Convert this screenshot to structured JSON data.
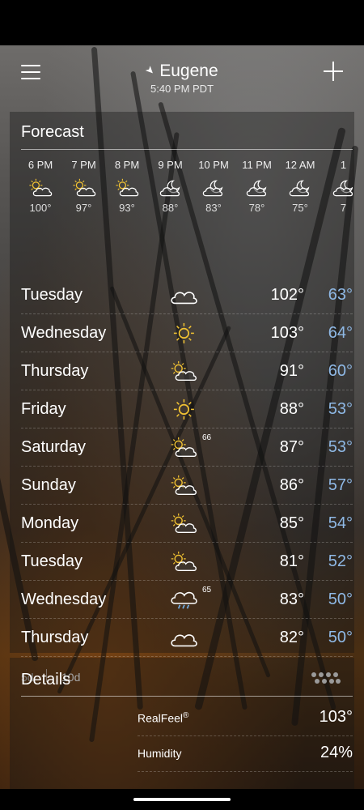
{
  "header": {
    "location": "Eugene",
    "time": "5:40 PM PDT"
  },
  "forecast": {
    "title": "Forecast",
    "hourly": [
      {
        "time": "6 PM",
        "icon": "partly-sunny-icon",
        "temp": "100°"
      },
      {
        "time": "7 PM",
        "icon": "partly-sunny-icon",
        "temp": "97°"
      },
      {
        "time": "8 PM",
        "icon": "partly-sunny-icon",
        "temp": "93°"
      },
      {
        "time": "9 PM",
        "icon": "partly-cloudy-night-icon",
        "temp": "88°"
      },
      {
        "time": "10 PM",
        "icon": "partly-cloudy-night-icon",
        "temp": "83°"
      },
      {
        "time": "11 PM",
        "icon": "partly-cloudy-night-icon",
        "temp": "78°"
      },
      {
        "time": "12 AM",
        "icon": "partly-cloudy-night-icon",
        "temp": "75°"
      },
      {
        "time": "1",
        "icon": "partly-cloudy-night-icon",
        "temp": "7"
      }
    ],
    "daily": [
      {
        "day": "Tuesday",
        "icon": "cloudy-icon",
        "precip": "",
        "high": "102°",
        "low": "63°"
      },
      {
        "day": "Wednesday",
        "icon": "sunny-icon",
        "precip": "",
        "high": "103°",
        "low": "64°"
      },
      {
        "day": "Thursday",
        "icon": "partly-sunny-icon",
        "precip": "",
        "high": "91°",
        "low": "60°"
      },
      {
        "day": "Friday",
        "icon": "sunny-icon",
        "precip": "",
        "high": "88°",
        "low": "53°"
      },
      {
        "day": "Saturday",
        "icon": "partly-sunny-icon",
        "precip": "66",
        "high": "87°",
        "low": "53°"
      },
      {
        "day": "Sunday",
        "icon": "partly-sunny-icon",
        "precip": "",
        "high": "86°",
        "low": "57°"
      },
      {
        "day": "Monday",
        "icon": "partly-sunny-icon",
        "precip": "",
        "high": "85°",
        "low": "54°"
      },
      {
        "day": "Tuesday",
        "icon": "partly-sunny-icon",
        "precip": "",
        "high": "81°",
        "low": "52°"
      },
      {
        "day": "Wednesday",
        "icon": "rain-icon",
        "precip": "65",
        "high": "83°",
        "low": "50°"
      },
      {
        "day": "Thursday",
        "icon": "cloudy-icon",
        "precip": "",
        "high": "82°",
        "low": "50°"
      }
    ],
    "range_tabs": [
      "5d",
      "10d"
    ],
    "selected_range": "10d"
  },
  "details": {
    "title": "Details",
    "items": [
      {
        "label": "RealFeel",
        "sup": "®",
        "value": "103°"
      },
      {
        "label": "Humidity",
        "sup": "",
        "value": "24%"
      }
    ]
  },
  "colors": {
    "sun": "#f1c232",
    "low_temp": "#8fb9e6",
    "rain_drop": "#6fa8dc"
  }
}
